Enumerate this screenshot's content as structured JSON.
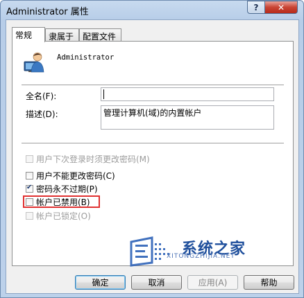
{
  "window": {
    "title": "Administrator 属性",
    "help_symbol": "?",
    "close_symbol": "✕"
  },
  "tabs": [
    {
      "label": "常规",
      "active": true
    },
    {
      "label": "隶属于",
      "active": false
    },
    {
      "label": "配置文件",
      "active": false
    }
  ],
  "user": {
    "name": "Administrator",
    "icon": "user-icon"
  },
  "fields": {
    "fullname_label": "全名(F):",
    "fullname_value": "",
    "description_label": "描述(D):",
    "description_value": "管理计算机(域)的内置帐户"
  },
  "checkboxes": [
    {
      "label": "用户下次登录时须更改密码(M)",
      "checked": false,
      "enabled": false
    },
    {
      "label": "用户不能更改密码(C)",
      "checked": false,
      "enabled": true
    },
    {
      "label": "密码永不过期(P)",
      "checked": true,
      "enabled": true
    },
    {
      "label": "帐户已禁用(B)",
      "checked": false,
      "enabled": true
    },
    {
      "label": "帐户已锁定(O)",
      "checked": false,
      "enabled": false
    }
  ],
  "watermark": {
    "cn": "系统之家",
    "en": "XITONGZHIJIA.NET"
  },
  "buttons": {
    "ok": "确定",
    "cancel": "取消",
    "apply": "应用(A)",
    "help": "帮助"
  },
  "colors": {
    "highlight_box": "#e03030",
    "watermark": "#1f4f9c"
  }
}
